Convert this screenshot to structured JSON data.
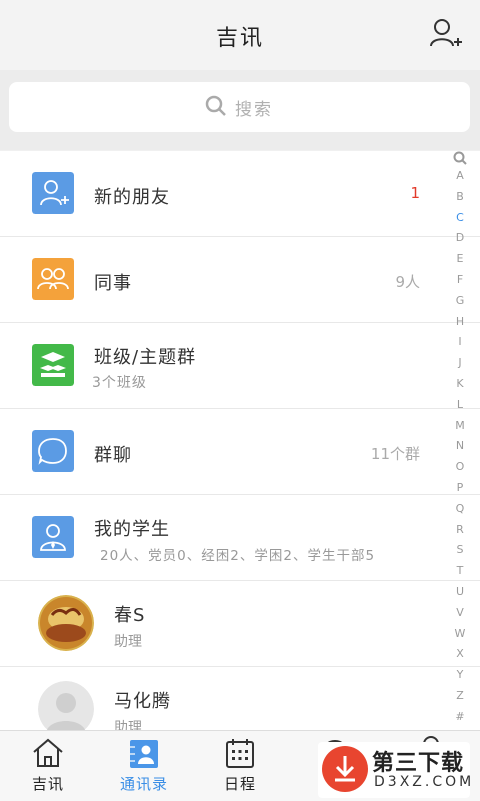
{
  "header": {
    "title": "吉讯",
    "add_contact_icon": "add-contact-icon"
  },
  "search": {
    "placeholder": "搜索"
  },
  "sections": [
    {
      "title": "新的朋友",
      "badge": "1",
      "icon": "new-friend-icon",
      "color": "#5b9be4"
    },
    {
      "title": "同事",
      "right": "9人",
      "icon": "colleagues-icon",
      "color": "#f4a23b"
    },
    {
      "title": "班级/主题群",
      "subtitle": "3个班级",
      "icon": "class-group-icon",
      "color": "#43b949"
    },
    {
      "title": "群聊",
      "right": "11个群",
      "icon": "group-chat-icon",
      "color": "#5b9be4"
    },
    {
      "title": "我的学生",
      "subtitle": "20人、党员0、经困2、学困2、学生干部5",
      "icon": "student-icon",
      "color": "#5b9be4"
    }
  ],
  "contacts": [
    {
      "name": "春S",
      "role": "助理"
    },
    {
      "name": "马化腾",
      "role": "助理"
    }
  ],
  "index_letters": [
    "A",
    "B",
    "C",
    "D",
    "E",
    "F",
    "G",
    "H",
    "I",
    "J",
    "K",
    "L",
    "M",
    "N",
    "O",
    "P",
    "Q",
    "R",
    "S",
    "T",
    "U",
    "V",
    "W",
    "X",
    "Y",
    "Z",
    "#"
  ],
  "index_active": "C",
  "tabs": [
    {
      "label": "吉讯",
      "icon": "home-icon"
    },
    {
      "label": "通讯录",
      "icon": "contacts-icon",
      "active": true
    },
    {
      "label": "日程",
      "icon": "calendar-icon"
    }
  ],
  "watermark": {
    "title": "第三下载",
    "url": "D3XZ.COM"
  },
  "colors": {
    "accent": "#3a8ee6",
    "badge": "#e23a2a"
  }
}
